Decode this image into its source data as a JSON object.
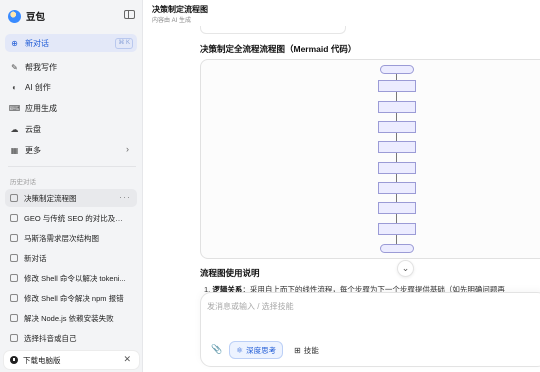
{
  "app": {
    "name": "豆包"
  },
  "sidebar": {
    "primary": [
      {
        "label": "新对话",
        "icon": "new-chat-icon",
        "shortcut": "⌘ K",
        "active": true
      },
      {
        "label": "帮我写作",
        "icon": "pen-icon"
      },
      {
        "label": "AI 创作",
        "icon": "palette-icon"
      },
      {
        "label": "应用生成",
        "icon": "code-icon"
      },
      {
        "label": "云盘",
        "icon": "cloud-drive-icon"
      },
      {
        "label": "更多",
        "icon": "grid-icon"
      }
    ],
    "history_label": "历史对话",
    "history": [
      {
        "label": "决策制定流程图",
        "active": true
      },
      {
        "label": "GEO 与传统 SEO 的对比及应..."
      },
      {
        "label": "马斯洛需求层次结构图"
      },
      {
        "label": "新对话"
      },
      {
        "label": "修改 Shell 命令以解决 tokeni..."
      },
      {
        "label": "修改 Shell 命令解决 npm 报错"
      },
      {
        "label": "解决 Node.js 依赖安装失败"
      },
      {
        "label": "选择抖音或自己"
      }
    ],
    "download": {
      "label": "下载电脑版"
    }
  },
  "chat": {
    "title": "决策制定流程图",
    "subtitle": "内容由 AI 生成",
    "heading_mermaid": "决策制定全流程流程图（Mermaid 代码）",
    "heading_usage": "流程图使用说明",
    "usage_prefix": "1. ",
    "usage_bold": "逻辑关系",
    "usage_text": "：采用自上而下的线性流程，每个步骤为下一个步骤提供基础（如先明确问题再"
  },
  "input": {
    "placeholder": "发消息或输入 / 选择技能",
    "deep_think_label": "深度思考",
    "skills_label": "技能"
  },
  "colors": {
    "accent": "#1f5bd6",
    "active_bg": "#e3e8f8",
    "node_fill": "#ececff",
    "node_border": "#9b9bd6"
  }
}
